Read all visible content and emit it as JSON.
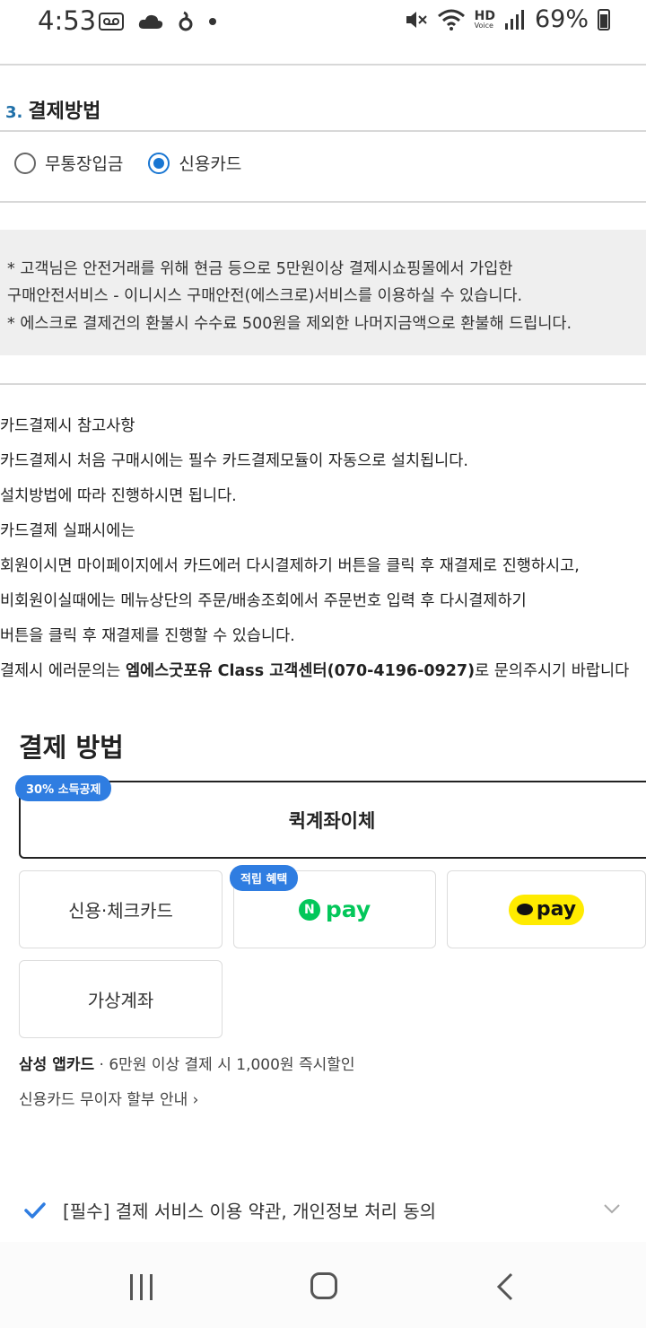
{
  "status_bar": {
    "time": "4:53",
    "battery": "69%",
    "hd_label": "HD",
    "voice_label": "Voice"
  },
  "payment_section": {
    "number": "3.",
    "title": "결제방법",
    "options": [
      {
        "label": "무통장입금",
        "selected": false
      },
      {
        "label": "신용카드",
        "selected": true
      }
    ]
  },
  "notice": {
    "lines": [
      "* 고객님은 안전거래를 위해 현금 등으로 5만원이상 결제시쇼핑몰에서 가입한",
      "구매안전서비스 - 이니시스 구매안전(에스크로)서비스를 이용하실 수 있습니다.",
      "* 에스크로 결제건의 환불시 수수료 500원을 제외한 나머지금액으로 환불해 드립니다."
    ]
  },
  "card_info": {
    "lines": [
      "카드결제시 참고사항",
      " 카드결제시 처음 구매시에는 필수 카드결제모듈이 자동으로 설치됩니다.",
      "설치방법에 따라 진행하시면 됩니다.",
      " 카드결제 실패시에는",
      "회원이시면 마이페이지에서 카드에러 다시결제하기 버튼을 클릭 후 재결제로 진행하시고,",
      "비회원이실때에는 메뉴상단의 주문/배송조회에서 주문번호 입력 후 다시결제하기",
      "버튼을 클릭 후 재결제를 진행할 수 있습니다."
    ],
    "error_prefix": " 결제시 에러문의는 ",
    "error_bold": "엠에스굿포유 Class 고객센터(070-4196-0927)",
    "error_suffix": "로 문의주시기 바랍니다"
  },
  "payment_methods": {
    "title": "결제 방법",
    "quick_transfer": {
      "label": "퀵계좌이체",
      "badge": "30% 소득공제"
    },
    "credit_card": "신용·체크카드",
    "npay": {
      "mark": "N",
      "text": "pay",
      "badge": "적립 혜택"
    },
    "kakaopay": {
      "text": "pay"
    },
    "virtual_account": "가상계좌",
    "samsung_card_bold": "삼성 앱카드",
    "samsung_card_text": " · 6만원 이상 결제 시 1,000원 즉시할인",
    "installment_link": "신용카드 무이자 할부 안내 ›"
  },
  "agreement": {
    "label": "[필수] 결제 서비스 이용 약관, 개인정보 처리 동의"
  },
  "colors": {
    "accent": "#2f7de1",
    "radio_selected": "#1976d2",
    "npay_green": "#03c75a",
    "kakao_yellow": "#ffeb00",
    "notice_bg": "#efefef"
  }
}
